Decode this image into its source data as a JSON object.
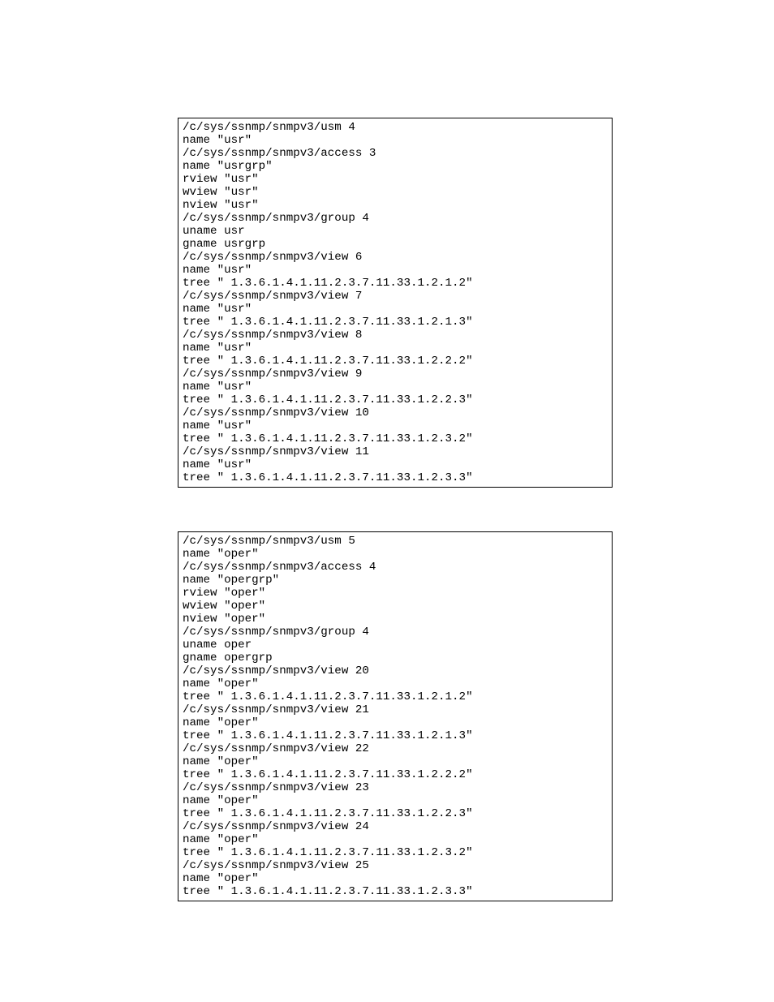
{
  "blocks": [
    {
      "lines": [
        "/c/sys/ssnmp/snmpv3/usm 4",
        "name \"usr\"",
        "/c/sys/ssnmp/snmpv3/access 3",
        "name \"usrgrp\"",
        "rview \"usr\"",
        "wview \"usr\"",
        "nview \"usr\"",
        "/c/sys/ssnmp/snmpv3/group 4",
        "uname usr",
        "gname usrgrp",
        "/c/sys/ssnmp/snmpv3/view 6",
        "name \"usr\"",
        "tree \" 1.3.6.1.4.1.11.2.3.7.11.33.1.2.1.2\"",
        "/c/sys/ssnmp/snmpv3/view 7",
        "name \"usr\"",
        "tree \" 1.3.6.1.4.1.11.2.3.7.11.33.1.2.1.3\"",
        "/c/sys/ssnmp/snmpv3/view 8",
        "name \"usr\"",
        "tree \" 1.3.6.1.4.1.11.2.3.7.11.33.1.2.2.2\"",
        "/c/sys/ssnmp/snmpv3/view 9",
        "name \"usr\"",
        "tree \" 1.3.6.1.4.1.11.2.3.7.11.33.1.2.2.3\"",
        "/c/sys/ssnmp/snmpv3/view 10",
        "name \"usr\"",
        "tree \" 1.3.6.1.4.1.11.2.3.7.11.33.1.2.3.2\"",
        "/c/sys/ssnmp/snmpv3/view 11",
        "name \"usr\"",
        "tree \" 1.3.6.1.4.1.11.2.3.7.11.33.1.2.3.3\""
      ]
    },
    {
      "lines": [
        "/c/sys/ssnmp/snmpv3/usm 5",
        "name \"oper\"",
        "/c/sys/ssnmp/snmpv3/access 4",
        "name \"opergrp\"",
        "rview \"oper\"",
        "wview \"oper\"",
        "nview \"oper\"",
        "/c/sys/ssnmp/snmpv3/group 4",
        "uname oper",
        "gname opergrp",
        "/c/sys/ssnmp/snmpv3/view 20",
        "name \"oper\"",
        "tree \" 1.3.6.1.4.1.11.2.3.7.11.33.1.2.1.2\"",
        "/c/sys/ssnmp/snmpv3/view 21",
        "name \"oper\"",
        "tree \" 1.3.6.1.4.1.11.2.3.7.11.33.1.2.1.3\"",
        "/c/sys/ssnmp/snmpv3/view 22",
        "name \"oper\"",
        "tree \" 1.3.6.1.4.1.11.2.3.7.11.33.1.2.2.2\"",
        "/c/sys/ssnmp/snmpv3/view 23",
        "name \"oper\"",
        "tree \" 1.3.6.1.4.1.11.2.3.7.11.33.1.2.2.3\"",
        "/c/sys/ssnmp/snmpv3/view 24",
        "name \"oper\"",
        "tree \" 1.3.6.1.4.1.11.2.3.7.11.33.1.2.3.2\"",
        "/c/sys/ssnmp/snmpv3/view 25",
        "name \"oper\"",
        "tree \" 1.3.6.1.4.1.11.2.3.7.11.33.1.2.3.3\""
      ]
    }
  ]
}
